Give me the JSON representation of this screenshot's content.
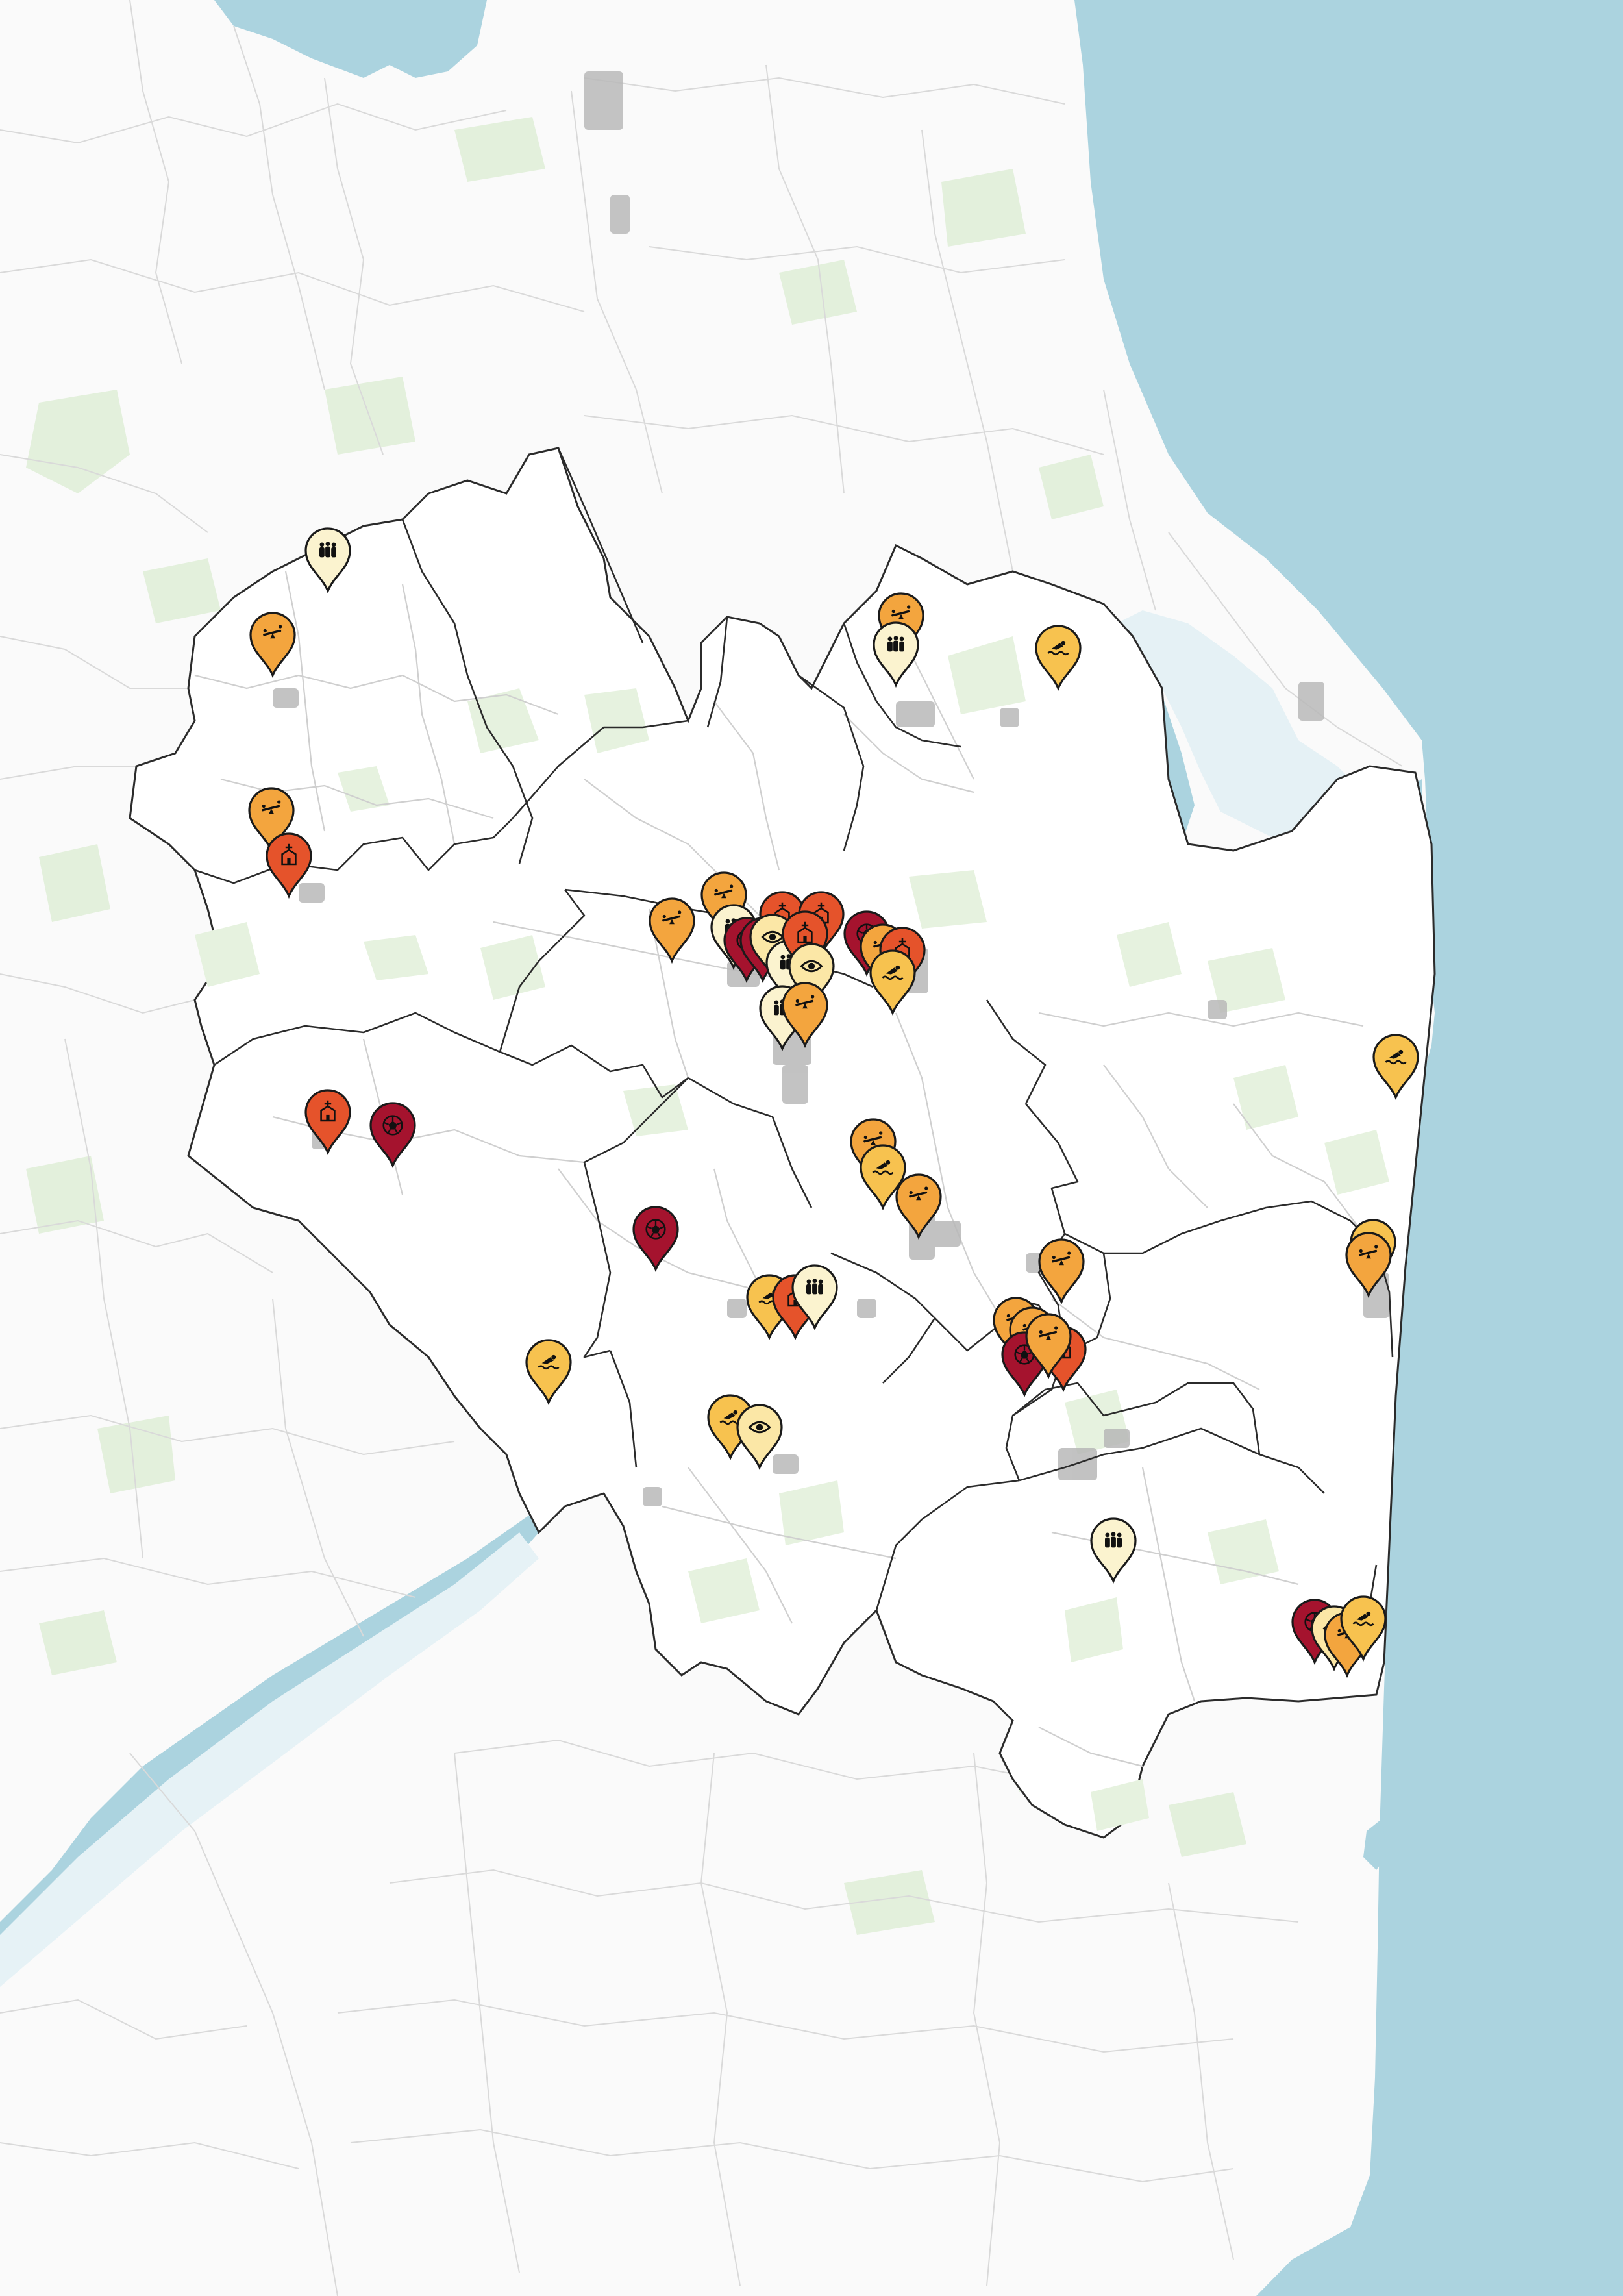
{
  "map": {
    "colors": {
      "sea": "#abd3df",
      "land": "#ffffff",
      "outside_land": "#fafafa",
      "green": "#e3f0dc",
      "roads": "#d9d9d9",
      "outside_border": "#bdbdbd",
      "district_border": "#2b2b2b",
      "town": "#b8b8b8"
    },
    "category_styles": {
      "playground": {
        "color": "#f3a53e",
        "icon": "seesaw-icon"
      },
      "swimming": {
        "color": "#f7c24f",
        "icon": "swimmer-icon"
      },
      "community": {
        "color": "#fbf3cf",
        "icon": "people-group-icon"
      },
      "viewpoint": {
        "color": "#fbe7a6",
        "icon": "eye-icon"
      },
      "church": {
        "color": "#e5532b",
        "icon": "church-icon"
      },
      "football": {
        "color": "#a5132e",
        "icon": "football-icon"
      }
    },
    "markers": [
      {
        "id": "m01",
        "category": "community"
      },
      {
        "id": "m02",
        "category": "playground"
      },
      {
        "id": "m03",
        "category": "playground"
      },
      {
        "id": "m04",
        "category": "church"
      },
      {
        "id": "m05",
        "category": "playground"
      },
      {
        "id": "m06",
        "category": "community"
      },
      {
        "id": "m07",
        "category": "swimming"
      },
      {
        "id": "m08",
        "category": "playground"
      },
      {
        "id": "m09",
        "category": "playground"
      },
      {
        "id": "m10",
        "category": "community"
      },
      {
        "id": "m11",
        "category": "football"
      },
      {
        "id": "m12",
        "category": "church"
      },
      {
        "id": "m13",
        "category": "church"
      },
      {
        "id": "m14",
        "category": "football"
      },
      {
        "id": "m15",
        "category": "viewpoint"
      },
      {
        "id": "m16",
        "category": "community"
      },
      {
        "id": "m17",
        "category": "church"
      },
      {
        "id": "m18",
        "category": "viewpoint"
      },
      {
        "id": "m19",
        "category": "community"
      },
      {
        "id": "m20",
        "category": "playground"
      },
      {
        "id": "m21",
        "category": "football"
      },
      {
        "id": "m22",
        "category": "playground"
      },
      {
        "id": "m23",
        "category": "church"
      },
      {
        "id": "m24",
        "category": "swimming"
      },
      {
        "id": "m25",
        "category": "church"
      },
      {
        "id": "m26",
        "category": "football"
      },
      {
        "id": "m27",
        "category": "playground"
      },
      {
        "id": "m28",
        "category": "swimming"
      },
      {
        "id": "m29",
        "category": "playground"
      },
      {
        "id": "m30",
        "category": "football"
      },
      {
        "id": "m31",
        "category": "swimming"
      },
      {
        "id": "m32",
        "category": "church"
      },
      {
        "id": "m33",
        "category": "community"
      },
      {
        "id": "m34",
        "category": "swimming"
      },
      {
        "id": "m35",
        "category": "playground"
      },
      {
        "id": "m36",
        "category": "swimming"
      },
      {
        "id": "m37",
        "category": "viewpoint"
      },
      {
        "id": "m38",
        "category": "playground"
      },
      {
        "id": "m39",
        "category": "playground"
      },
      {
        "id": "m40",
        "category": "football"
      },
      {
        "id": "m41",
        "category": "church"
      },
      {
        "id": "m42",
        "category": "playground"
      },
      {
        "id": "m43",
        "category": "swimming"
      },
      {
        "id": "m44",
        "category": "swimming"
      },
      {
        "id": "m45",
        "category": "playground"
      },
      {
        "id": "m46",
        "category": "community"
      },
      {
        "id": "m47",
        "category": "football"
      },
      {
        "id": "m48",
        "category": "viewpoint"
      },
      {
        "id": "m49",
        "category": "playground"
      },
      {
        "id": "m50",
        "category": "swimming"
      }
    ]
  }
}
